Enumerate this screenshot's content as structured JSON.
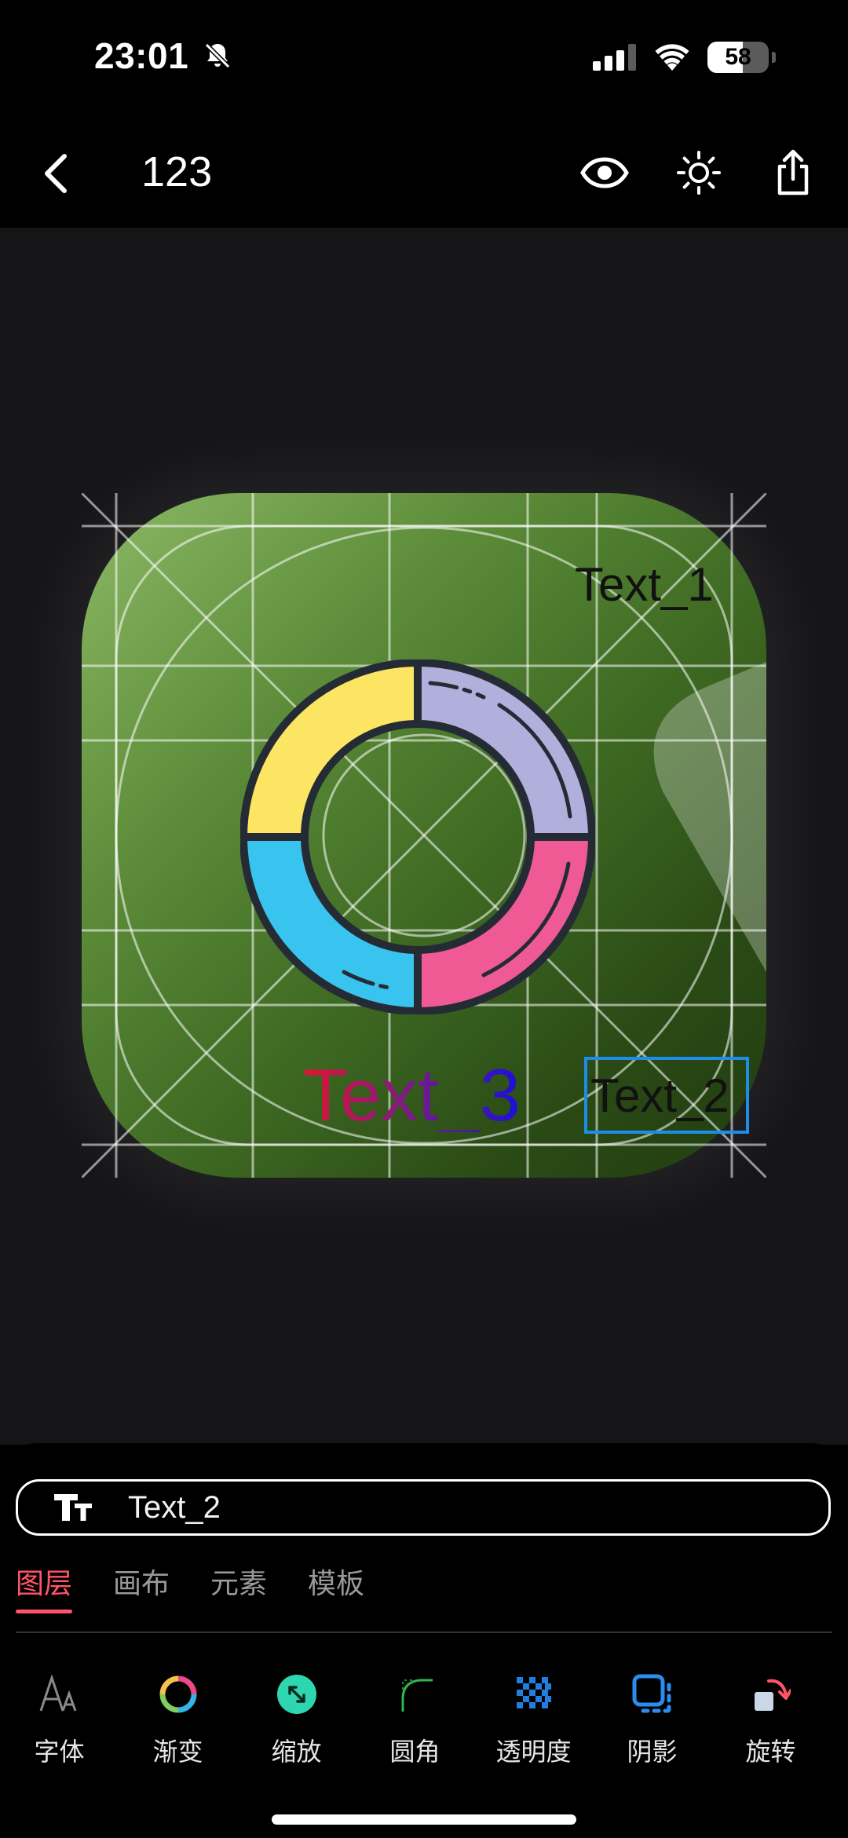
{
  "status_bar": {
    "time": "23:01",
    "battery": "58",
    "battery_level": 0.58
  },
  "nav": {
    "title": "123"
  },
  "canvas": {
    "text_1": "Text_1",
    "text_2": "Text_2",
    "text_3": "Text_3"
  },
  "layer_input": {
    "value": "Text_2"
  },
  "tabs": [
    {
      "label": "图层",
      "active": true
    },
    {
      "label": "画布",
      "active": false
    },
    {
      "label": "元素",
      "active": false
    },
    {
      "label": "模板",
      "active": false
    }
  ],
  "tools": [
    {
      "label": "字体",
      "icon": "font-icon"
    },
    {
      "label": "渐变",
      "icon": "gradient-icon"
    },
    {
      "label": "缩放",
      "icon": "scale-icon"
    },
    {
      "label": "圆角",
      "icon": "corner-radius-icon"
    },
    {
      "label": "透明度",
      "icon": "opacity-icon"
    },
    {
      "label": "阴影",
      "icon": "shadow-icon"
    },
    {
      "label": "旋转",
      "icon": "rotate-icon"
    }
  ],
  "colors": {
    "accent": "#ff5468",
    "selection": "#1c8ee8"
  }
}
